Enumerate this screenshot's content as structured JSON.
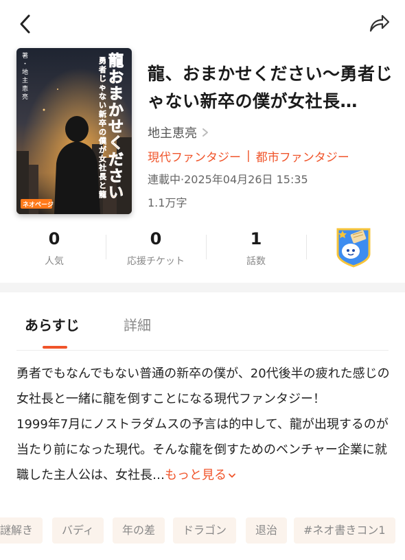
{
  "header": {
    "back_icon": "chevron-left-icon",
    "share_icon": "share-arrow-icon"
  },
  "cover": {
    "title_text": "龍おまかせください",
    "subtitle_text": "勇者じゃない新卒の僕が女社長と龍を倒す",
    "author_text": "著・地主恵亮",
    "publisher_logo": "ネオページ",
    "colors": {
      "title": "#ff7a1a",
      "sky": "#2a3142"
    }
  },
  "book": {
    "title": "龍、おまかせください〜勇者じゃない新卒の僕が女社長…",
    "author": "地主恵亮",
    "genres": [
      "現代ファンタジー",
      "都市ファンタジー"
    ],
    "genre_separator": "|",
    "status": "連載中·2025年04月26日 15:35",
    "char_count": "1.1万字"
  },
  "stats": [
    {
      "value": "0",
      "label": "人気"
    },
    {
      "value": "0",
      "label": "応援チケット"
    },
    {
      "value": "1",
      "label": "話数"
    }
  ],
  "badge": {
    "icon": "mascot-badge-icon"
  },
  "tabs": [
    {
      "label": "あらすじ",
      "active": true
    },
    {
      "label": "詳細",
      "active": false
    }
  ],
  "synopsis": {
    "text": "勇者でもなんでもない普通の新卒の僕が、20代後半の疲れた感じの女社長と一緒に龍を倒すことになる現代ファンタジー！",
    "text2": "1999年7月にノストラダムスの予言は的中して、龍が出現するのが当たり前になった現代。そんな龍を倒すためのベンチャー企業に就職した主人公は、女社長…",
    "more_label": "もっと見る"
  },
  "tags": [
    "謎解き",
    "バディ",
    "年の差",
    "ドラゴン",
    "退治",
    "#ネオ書きコン1"
  ],
  "accent_color": "#f0542a"
}
